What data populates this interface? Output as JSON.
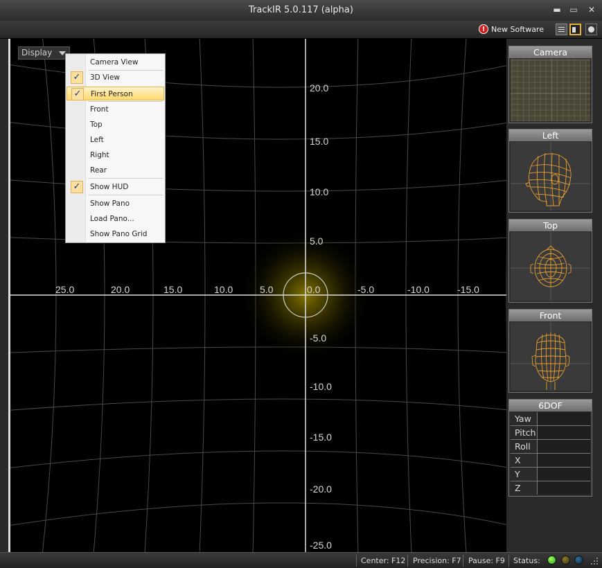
{
  "window": {
    "title": "TrackIR 5.0.117 (alpha)",
    "min_glyph": "▬",
    "max_glyph": "▭",
    "close_glyph": "✕"
  },
  "toolbar": {
    "new_software_label": "New Software",
    "alert_glyph": "!"
  },
  "display_dropdown": {
    "label": "Display"
  },
  "display_menu": {
    "items": [
      {
        "label": "Camera View",
        "checked": false
      },
      {
        "label": "3D View",
        "checked": true
      },
      {
        "label": "First Person",
        "checked": true,
        "highlighted": true
      },
      {
        "label": "Front",
        "checked": false
      },
      {
        "label": "Top",
        "checked": false
      },
      {
        "label": "Left",
        "checked": false
      },
      {
        "label": "Right",
        "checked": false
      },
      {
        "label": "Rear",
        "checked": false
      },
      {
        "label": "Show HUD",
        "checked": true
      },
      {
        "label": "Show Pano",
        "checked": false
      },
      {
        "label": "Load Pano...",
        "checked": false
      },
      {
        "label": "Show Pano Grid",
        "checked": false
      }
    ],
    "check_glyph": "✓"
  },
  "viewport": {
    "h_tick_labels": [
      "0",
      "25.0",
      "20.0",
      "15.0",
      "10.0",
      "5.0",
      "0.0",
      "-5.0",
      "-10.0",
      "-15.0"
    ],
    "v_tick_labels": [
      "20.0",
      "15.0",
      "10.0",
      "5.0",
      "-5.0",
      "-10.0",
      "-15.0",
      "-20.0",
      "-25.0"
    ],
    "grid_color": "#4a4a4a",
    "axis_color": "#e0e0e0",
    "glow_color": "#6a6000"
  },
  "panels": {
    "camera": {
      "title": "Camera"
    },
    "left": {
      "title": "Left"
    },
    "top": {
      "title": "Top"
    },
    "front": {
      "title": "Front"
    },
    "sixdof": {
      "title": "6DOF",
      "rows": [
        {
          "label": "Yaw",
          "value": ""
        },
        {
          "label": "Pitch",
          "value": ""
        },
        {
          "label": "Roll",
          "value": ""
        },
        {
          "label": "X",
          "value": ""
        },
        {
          "label": "Y",
          "value": ""
        },
        {
          "label": "Z",
          "value": ""
        }
      ]
    },
    "head_color": "#e8a030"
  },
  "statusbar": {
    "center": "Center: F12",
    "precision": "Precision: F7",
    "pause": "Pause: F9",
    "status": "Status:"
  }
}
